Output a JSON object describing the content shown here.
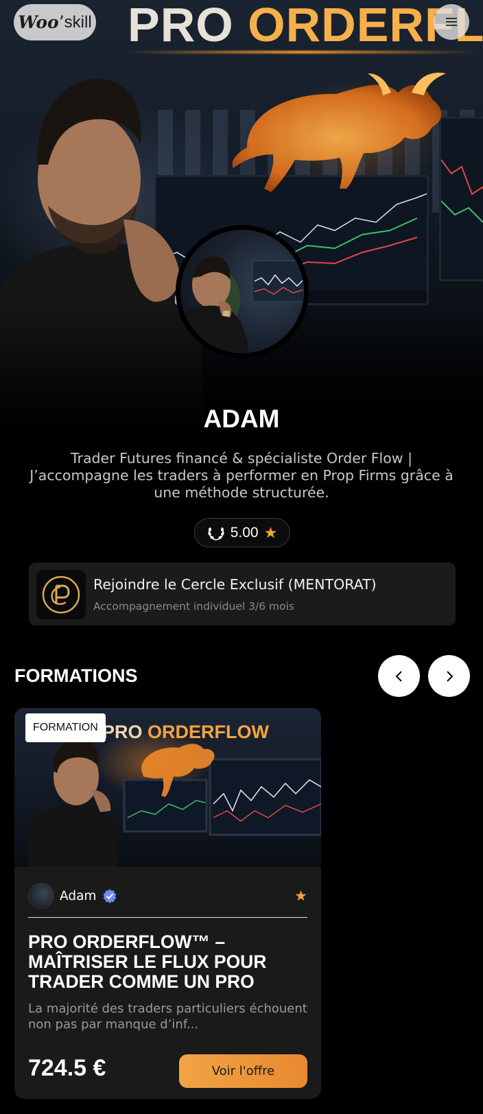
{
  "header": {
    "logo_word": "Woo",
    "logo_word2": "skill",
    "hero_title_white": "PRO",
    "hero_title_orange": "ORDERFLOW"
  },
  "profile": {
    "name": "ADAM",
    "bio": "Trader Futures financé & spécialiste Order Flow | J’accompagne les traders à performer en Prop Firms grâce à une méthode structurée.",
    "rating": "5.00"
  },
  "mentorship": {
    "title": "Rejoindre le Cercle Exclusif (MENTORAT)",
    "subtitle": "Accompagnement individuel 3/6 mois"
  },
  "formations": {
    "section_title": "FORMATIONS",
    "cards": [
      {
        "badge": "FORMATION",
        "cover_title_white": "PRO",
        "cover_title_orange": "ORDERFLOW",
        "author": "Adam",
        "title": "PRO ORDERFLOW™ – MAÎTRISER LE FLUX POUR TRADER COMME UN PRO",
        "description": "La majorité des traders particuliers échouent non pas par manque d’inf...",
        "price": "724.5 €",
        "cta": "Voir l'offre"
      }
    ]
  },
  "colors": {
    "accent": "#f7a531",
    "cta_start": "#f0a445",
    "cta_end": "#e8892f",
    "card_bg": "#1a1a1a",
    "verified": "#6b8df0"
  },
  "icons": {
    "menu": "hamburger-menu-icon",
    "rating": "laurel-wreath-icon",
    "star": "star-icon",
    "prev": "chevron-left-icon",
    "next": "chevron-right-icon",
    "verified": "verified-badge-icon"
  }
}
